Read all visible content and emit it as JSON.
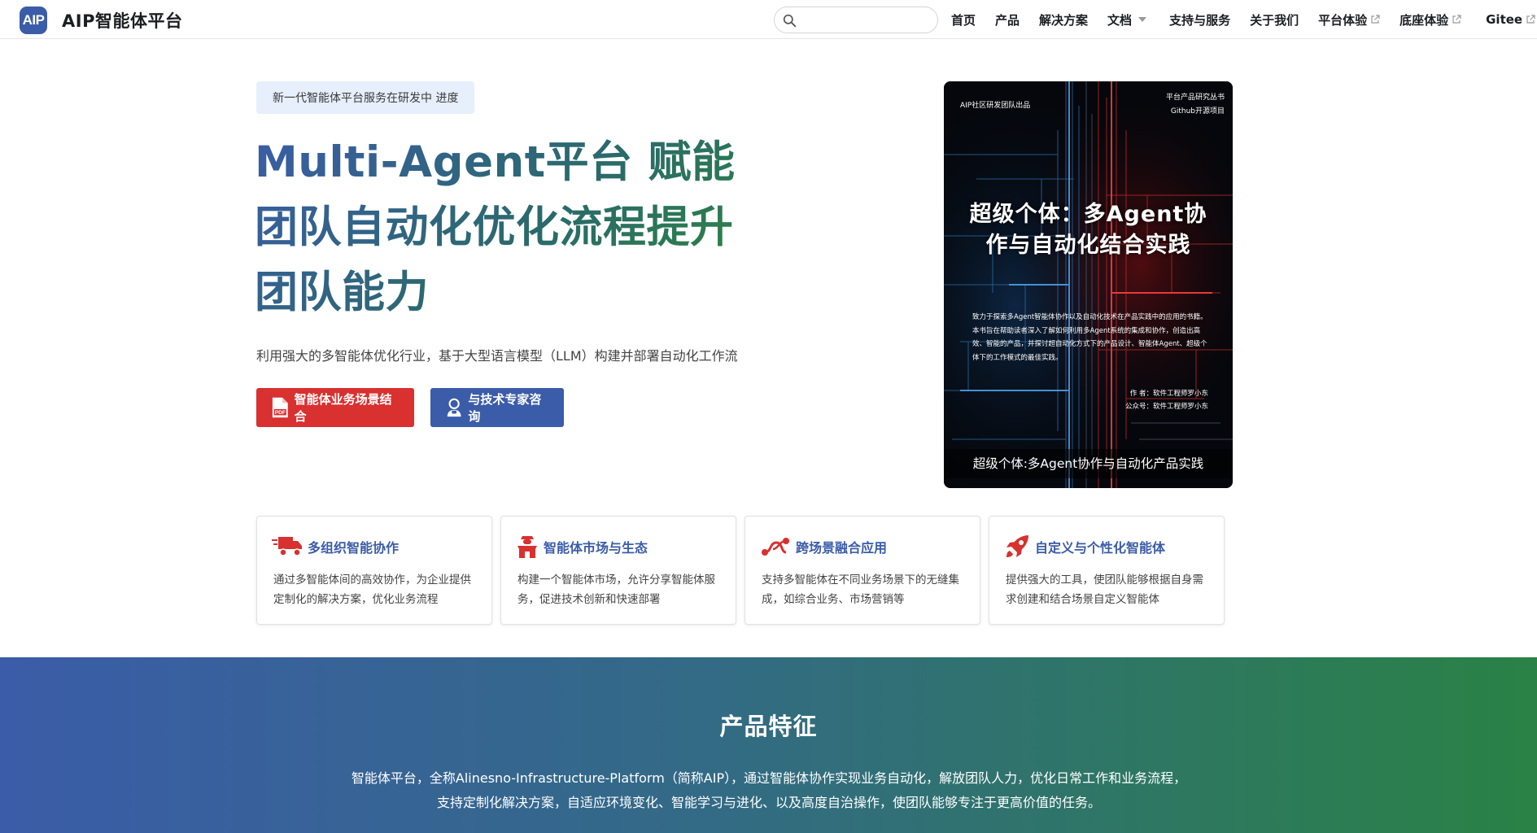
{
  "navbar": {
    "logo_text": "AIP",
    "title": "AIP智能体平台",
    "search_placeholder": "",
    "links": [
      {
        "label": "首页"
      },
      {
        "label": "产品"
      },
      {
        "label": "解决方案"
      },
      {
        "label": "文档"
      },
      {
        "label": "支持与服务"
      },
      {
        "label": "关于我们"
      },
      {
        "label": "平台体验"
      },
      {
        "label": "底座体验"
      },
      {
        "label": "Gitee"
      }
    ]
  },
  "hero": {
    "announcement": "新一代智能体平台服务在研发中 进度",
    "title": "Multi-Agent平台 赋能团队自动化优化流程提升团队能力",
    "subtitle": "利用强大的多智能体优化行业，基于大型语言模型（LLM）构建并部署自动化工作流",
    "primary_button": "智能体业务场景结合",
    "secondary_button": "与技术专家咨询"
  },
  "book": {
    "publisher": "AIP社区研发团队出品",
    "series_line1": "平台产品研究丛书",
    "series_line2": "Github开源项目",
    "title_line1": "超级个体：多Agent协",
    "title_line2": "作与自动化结合实践",
    "description": "致力于探索多Agent智能体协作以及自动化技术在产品实践中的应用的书籍。本书旨在帮助读者深入了解如何利用多Agent系统的集成和协作，创造出高效、智能的产品，并探讨超自动化方式下的产品设计、智能体Agent、超级个体下的工作模式的最佳实践。",
    "author_line1": "作 者：软件工程师罗小东",
    "author_line2": "公众号：软件工程师罗小东",
    "caption": "超级个体:多Agent协作与自动化产品实践"
  },
  "cards": [
    {
      "icon": "truck-icon",
      "title": "多组织智能协作",
      "desc": "通过多智能体间的高效协作，为企业提供定制化的解决方案，优化业务流程"
    },
    {
      "icon": "market-icon",
      "title": "智能体市场与生态",
      "desc": "构建一个智能体市场，允许分享智能体服务，促进技术创新和快速部署"
    },
    {
      "icon": "route-icon",
      "title": "跨场景融合应用",
      "desc": "支持多智能体在不同业务场景下的无缝集成，如综合业务、市场营销等"
    },
    {
      "icon": "rocket-icon",
      "title": "自定义与个性化智能体",
      "desc": "提供强大的工具，使团队能够根据自身需求创建和结合场景自定义智能体"
    }
  ],
  "features": {
    "title": "产品特征",
    "text": "智能体平台，全称Alinesno-Infrastructure-Platform（简称AIP），通过智能体协作实现业务自动化，解放团队人力，优化日常工作和业务流程，支持定制化解决方案，自适应环境变化、智能学习与进化、以及高度自治操作，使团队能够专注于更高价值的任务。"
  },
  "colors": {
    "brand_blue": "#3b5ca8",
    "brand_green": "#2d8a3a",
    "accent_red": "#d93030"
  }
}
